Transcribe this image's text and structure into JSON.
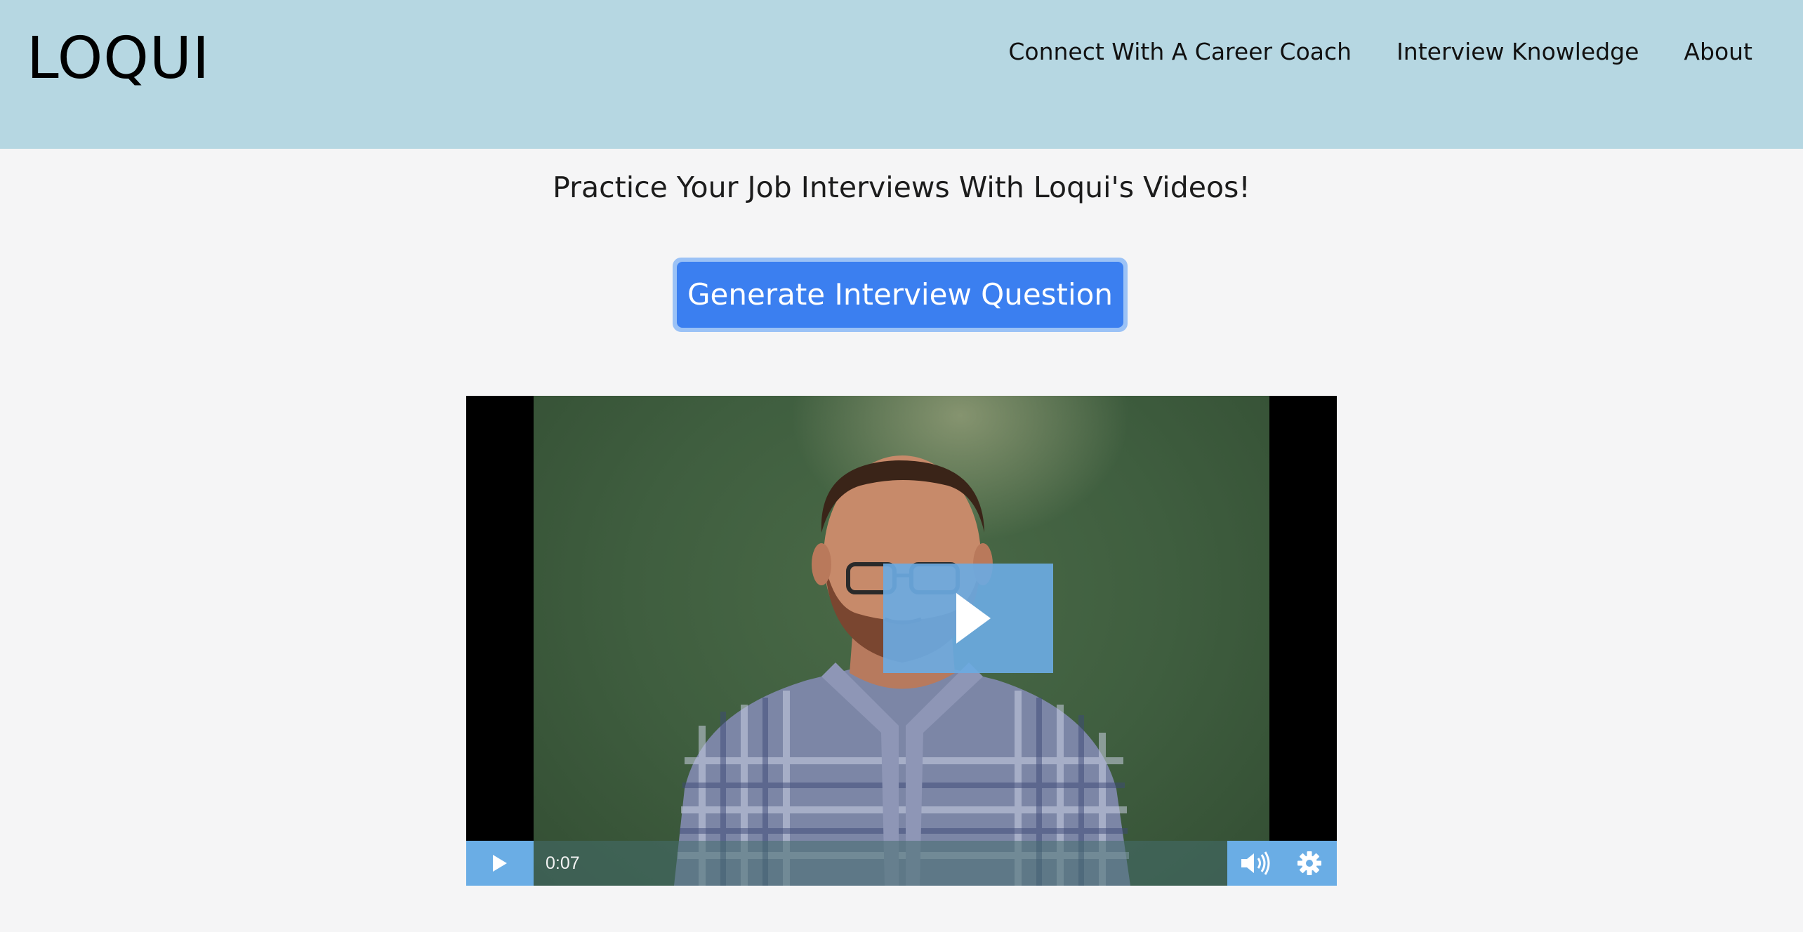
{
  "brand": {
    "logo": "LOQUI"
  },
  "nav": {
    "items": [
      {
        "label": "Connect With A Career Coach"
      },
      {
        "label": "Interview Knowledge"
      },
      {
        "label": "About"
      }
    ]
  },
  "main": {
    "headline": "Practice Your Job Interviews With Loqui's Videos!",
    "generate_button": "Generate Interview Question"
  },
  "video": {
    "current_time": "0:07",
    "icons": {
      "big_play": "play-icon",
      "control_play": "play-icon",
      "volume": "volume-icon",
      "settings": "gear-icon"
    }
  },
  "colors": {
    "header_bg": "#b6d7e2",
    "page_bg": "#f5f5f6",
    "button_bg": "#3b7ff0",
    "button_ring": "#9bc2f6",
    "player_accent": "#6aade5"
  }
}
